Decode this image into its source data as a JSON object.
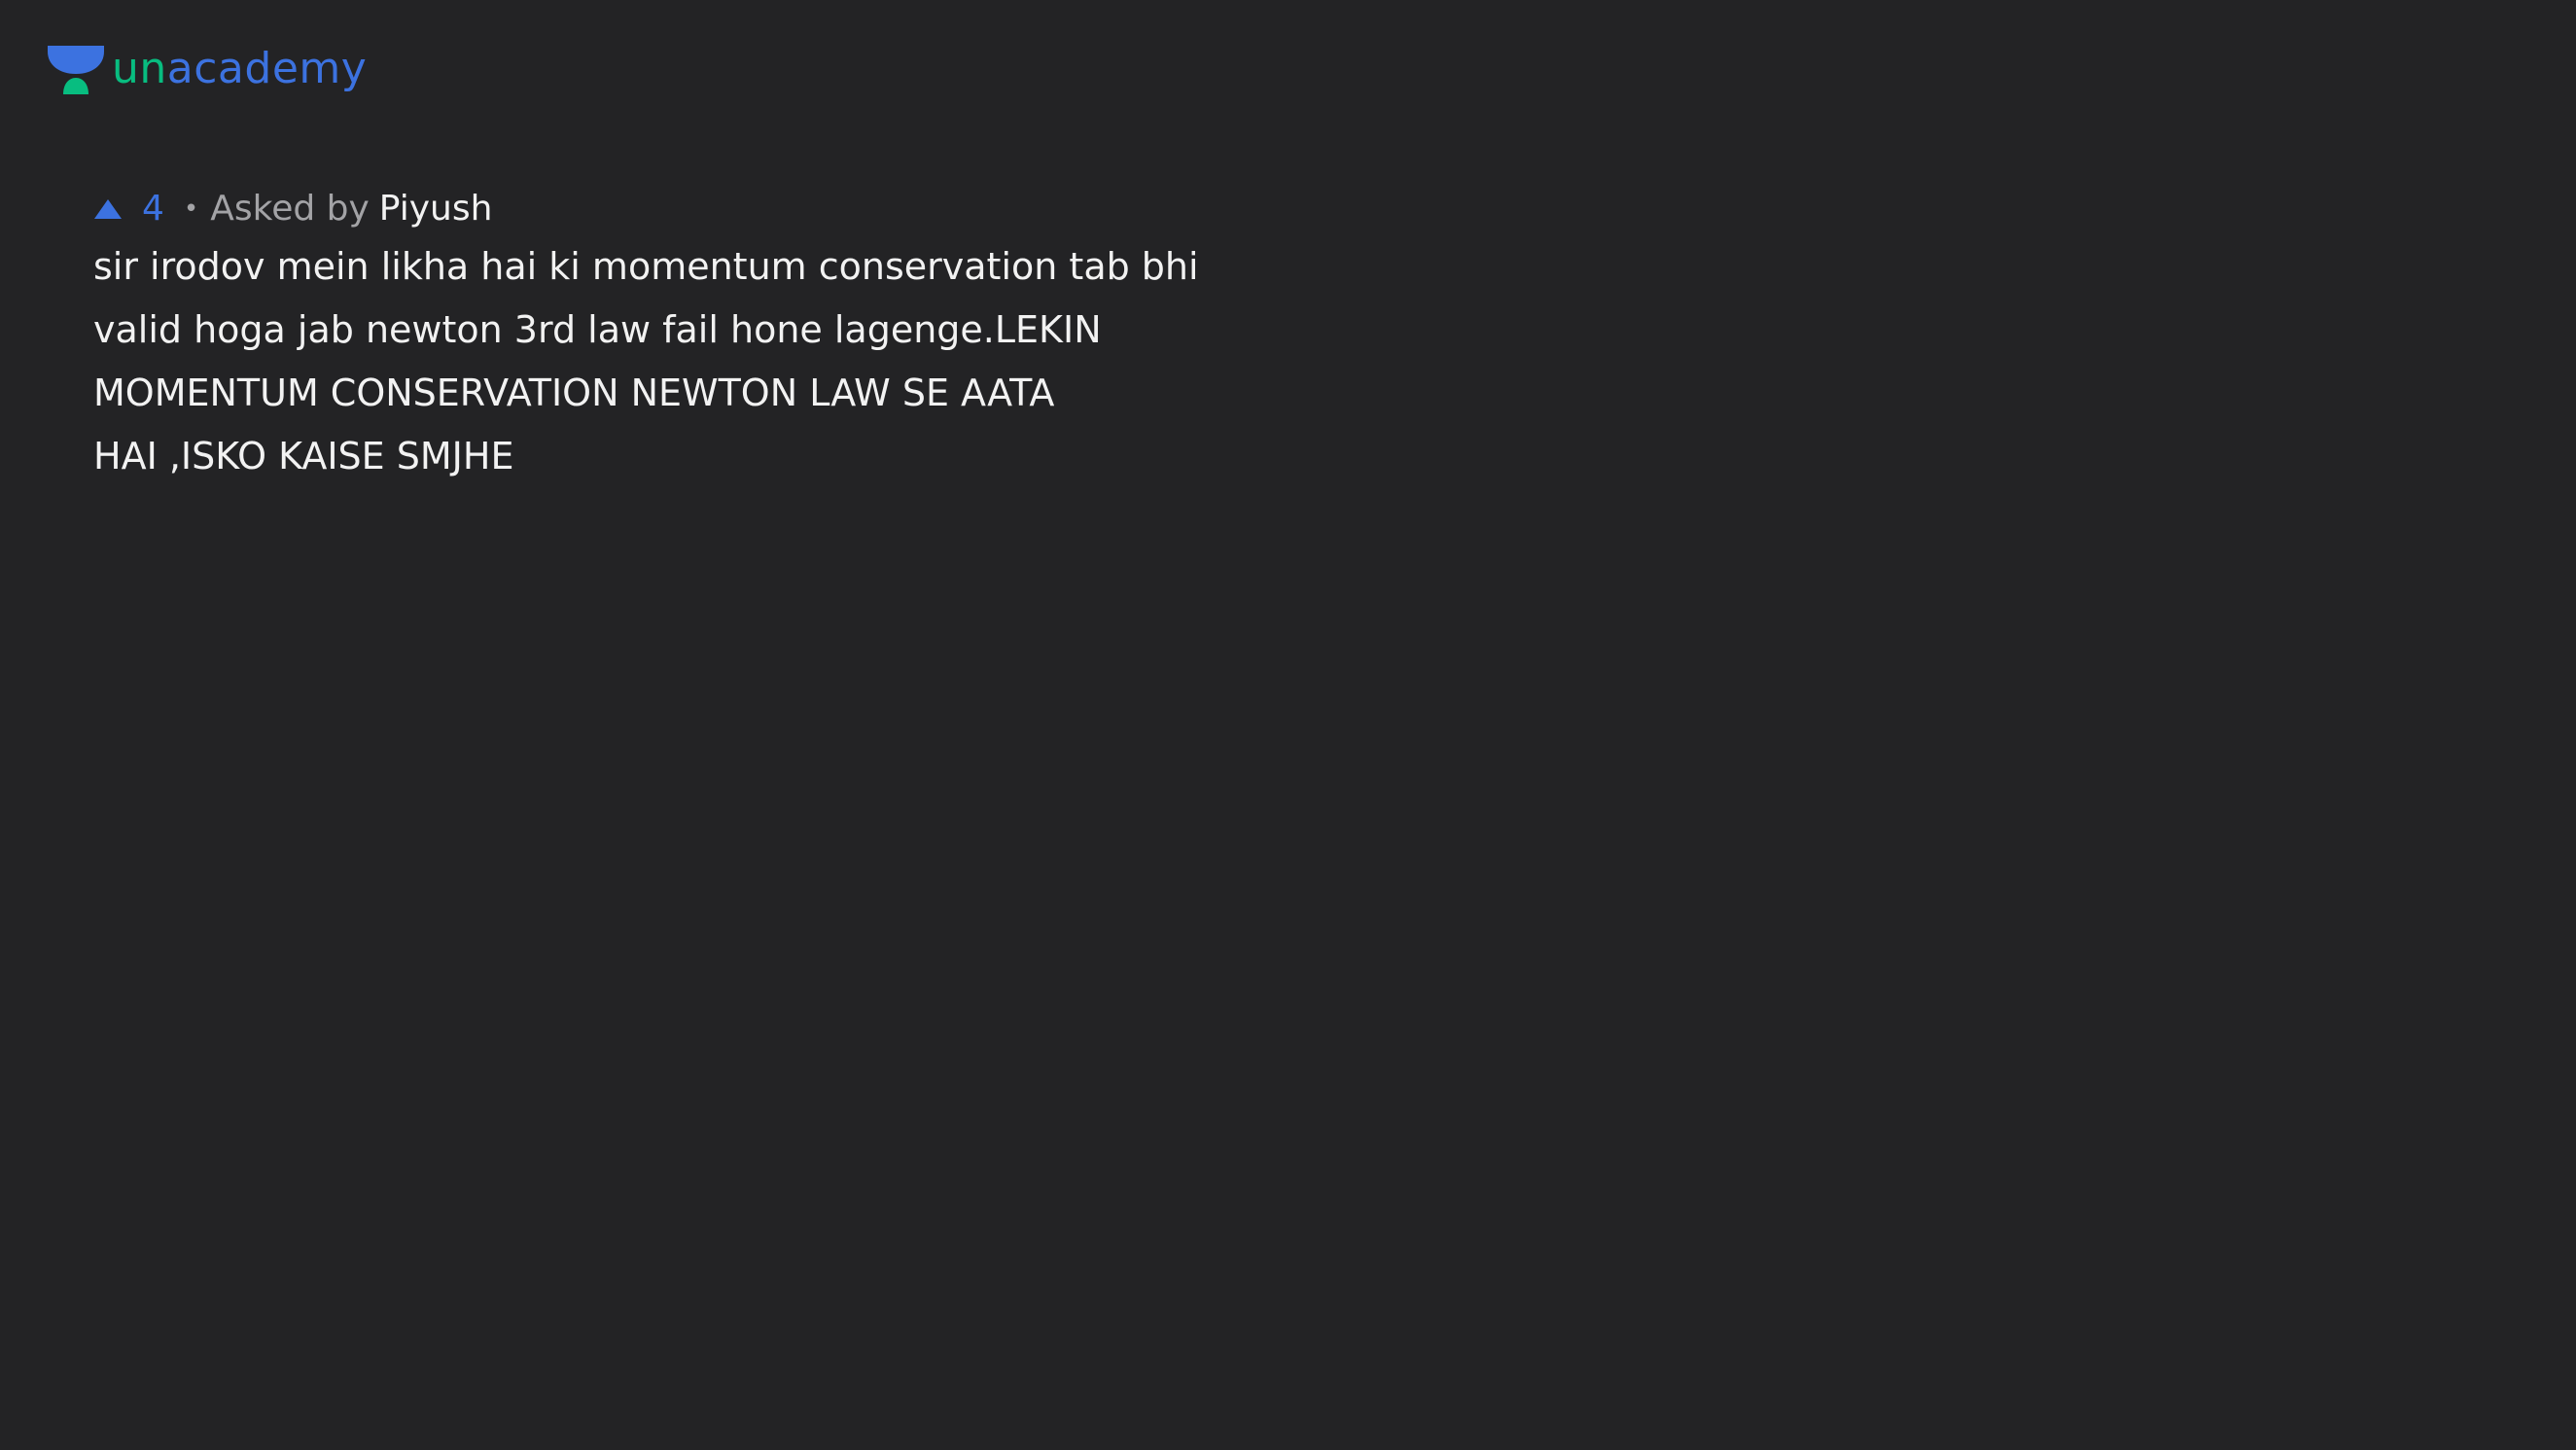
{
  "brand": {
    "name": "unacademy",
    "logo_icon": "unacademy-cap-icon",
    "color_green": "#08bd80",
    "color_blue": "#3c72e0"
  },
  "question": {
    "upvote_icon": "triangle-up-icon",
    "upvote_count": "4",
    "separator": "•",
    "asked_by_label": "Asked by",
    "asker_name": "Piyush",
    "text": "sir irodov mein likha hai ki momentum conservation tab bhi\nvalid hoga jab newton 3rd law fail hone lagenge.LEKIN\nMOMENTUM CONSERVATION NEWTON LAW SE AATA\nHAI ,ISKO KAISE SMJHE"
  },
  "colors": {
    "background": "#232325",
    "accent_blue": "#3c72e0",
    "muted_text": "#a3a3a6",
    "primary_text": "#f2f2f2"
  }
}
